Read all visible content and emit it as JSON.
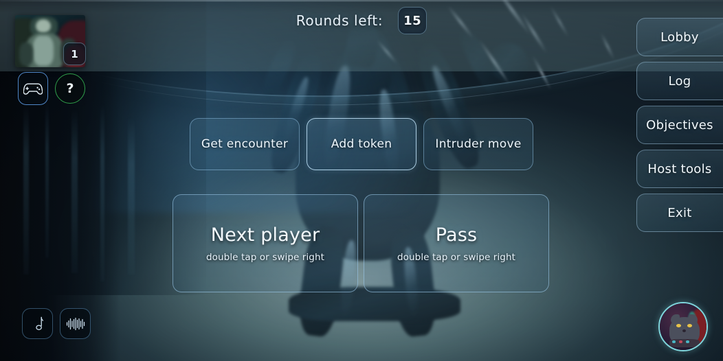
{
  "header": {
    "rounds_label": "Rounds left:",
    "rounds_value": "15"
  },
  "player_card": {
    "badge": "1",
    "portrait_alt": "player-portrait"
  },
  "quick_actions": {
    "gamepad_icon": "gamepad-icon",
    "help_icon": "question-mark-icon",
    "help_glyph": "?"
  },
  "actions": [
    {
      "id": "get-encounter",
      "label": "Get encounter",
      "primary": false
    },
    {
      "id": "add-token",
      "label": "Add token",
      "primary": true
    },
    {
      "id": "intruder-move",
      "label": "Intruder move",
      "primary": false
    }
  ],
  "turn_buttons": [
    {
      "id": "next-player",
      "title": "Next player",
      "subtitle": "double tap or swipe right"
    },
    {
      "id": "pass",
      "title": "Pass",
      "subtitle": "double tap or swipe right"
    }
  ],
  "sidebar": {
    "items": [
      {
        "id": "lobby",
        "label": "Lobby"
      },
      {
        "id": "log",
        "label": "Log"
      },
      {
        "id": "objectives",
        "label": "Objectives"
      },
      {
        "id": "host-tools",
        "label": "Host tools"
      },
      {
        "id": "exit",
        "label": "Exit"
      }
    ]
  },
  "audio": {
    "music_icon": "music-note-icon",
    "waveform_icon": "audio-waveform-icon"
  },
  "user": {
    "avatar_icon": "cat-avatar-icon"
  },
  "colors": {
    "accent_border": "#a0cdee",
    "accent_text": "#f1f8fc",
    "help_ring": "#2f9e4a",
    "gamepad_ring": "#4f86c6",
    "avatar_ring": "#7fd6dc",
    "bg_dark": "#06090e",
    "bg_mid": "#4d686d"
  }
}
